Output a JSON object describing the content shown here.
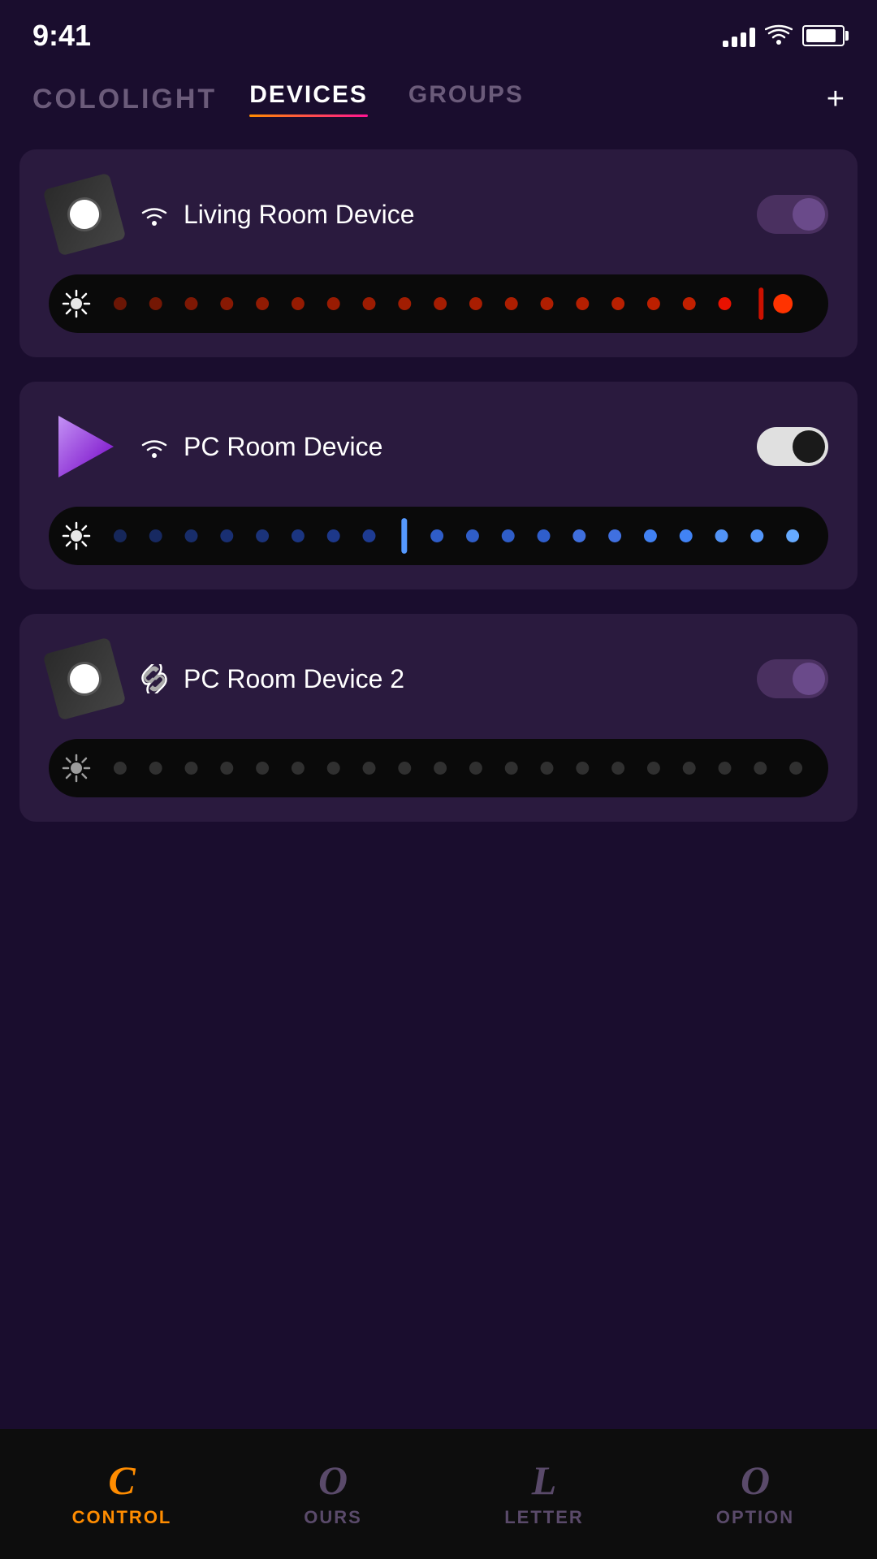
{
  "statusBar": {
    "time": "9:41"
  },
  "header": {
    "logo": "COLOLIGHT",
    "tabs": [
      {
        "id": "devices",
        "label": "DEVICES",
        "active": true
      },
      {
        "id": "groups",
        "label": "GROUPS",
        "active": false
      }
    ],
    "addButton": "+"
  },
  "devices": [
    {
      "id": "living-room",
      "name": "Living Room Device",
      "iconType": "disk",
      "connectionType": "wifi",
      "isOn": false,
      "sliderType": "red",
      "sliderPosition": 85
    },
    {
      "id": "pc-room",
      "name": "PC Room Device",
      "iconType": "play",
      "connectionType": "wifi",
      "isOn": true,
      "sliderType": "blue",
      "sliderPosition": 42
    },
    {
      "id": "pc-room-2",
      "name": "PC Room Device 2",
      "iconType": "disk",
      "connectionType": "link",
      "isOn": false,
      "sliderType": "gray",
      "sliderPosition": 0
    }
  ],
  "bottomNav": [
    {
      "id": "control",
      "icon": "C",
      "label": "CONTROL",
      "active": true
    },
    {
      "id": "ours",
      "icon": "O",
      "label": "OURS",
      "active": false
    },
    {
      "id": "letter",
      "icon": "L",
      "label": "LETTER",
      "active": false
    },
    {
      "id": "option",
      "icon": "O",
      "label": "OPTION",
      "active": false
    }
  ]
}
